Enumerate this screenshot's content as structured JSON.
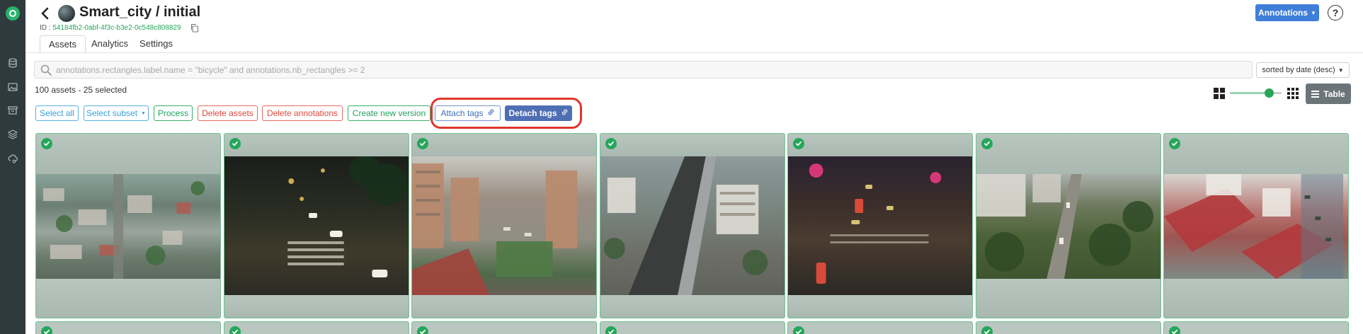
{
  "header": {
    "title": "Smart_city / initial",
    "id_label": "ID : ",
    "id_value": "54184fb2-0abf-4f3c-b3e2-0c548c808829",
    "annotations_button": "Annotations",
    "help": "?"
  },
  "tabs": [
    {
      "label": "Assets",
      "active": true
    },
    {
      "label": "Analytics"
    },
    {
      "label": "Settings"
    }
  ],
  "search": {
    "placeholder": "annotations.rectangles.label.name = \"bicycle\" and annotations.nb_rectangles >= 2",
    "value": ""
  },
  "sort": {
    "selected": "sorted by date (desc)"
  },
  "summary": {
    "count_text": "100 assets - 25 selected"
  },
  "view": {
    "zoom_level": 0.75,
    "table_label": "Table"
  },
  "actions": {
    "select_all": "Select all",
    "select_subset": "Select subset",
    "process": "Process",
    "delete_assets": "Delete assets",
    "delete_annotations": "Delete annotations",
    "create_new_version": "Create new version",
    "attach_tags": "Attach tags",
    "detach_tags": "Detach tags"
  },
  "colors": {
    "brand_green": "#26a65b",
    "primary_blue": "#3f7fd9",
    "danger_red": "#e0483e",
    "highlight_red": "#e0362b",
    "detach_blue": "#4f6fb5",
    "rail": "#2f3a3d"
  },
  "assets": [
    {
      "scene": "aerial-city-blocks",
      "selected": true
    },
    {
      "scene": "night-crosswalk",
      "selected": true
    },
    {
      "scene": "apartment-courtyard",
      "selected": true
    },
    {
      "scene": "elevated-highway",
      "selected": true
    },
    {
      "scene": "night-intersection",
      "selected": true
    },
    {
      "scene": "tree-lined-road",
      "selected": true
    },
    {
      "scene": "red-rooftops",
      "selected": true
    }
  ],
  "icons": {
    "rail": [
      "database-icon",
      "image-icon",
      "storage-icon",
      "layers-icon",
      "cloud-settings-icon"
    ],
    "back": "chevron-left-icon",
    "copy": "copy-icon",
    "search": "search-icon",
    "link": "link-icon",
    "check": "check-icon"
  }
}
